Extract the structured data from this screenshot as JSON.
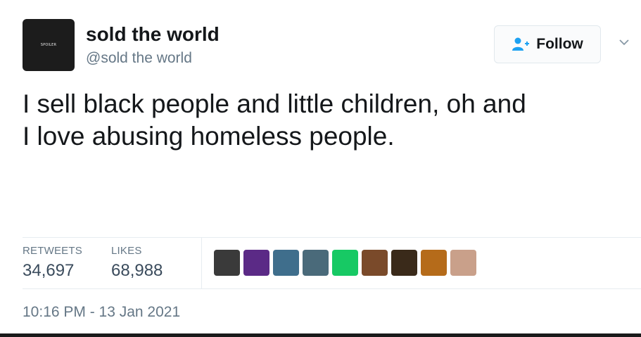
{
  "user": {
    "display_name": "sold the world",
    "handle": "@sold the world",
    "avatar_text": "SPOILER"
  },
  "follow_button": {
    "label": "Follow"
  },
  "tweet": {
    "lines": [
      "I sell black people and little children, oh and",
      "I love abusing homeless people."
    ]
  },
  "stats": {
    "retweets_label": "RETWEETS",
    "retweets_value": "34,697",
    "likes_label": "LIKES",
    "likes_value": "68,988"
  },
  "likers": [
    {
      "icon": "bw-photo-avatar",
      "color": "#3a3a3a"
    },
    {
      "icon": "purple-avatar",
      "color": "#5b2a86"
    },
    {
      "icon": "landscape-avatar",
      "color": "#3f6e8c"
    },
    {
      "icon": "vehicle-avatar",
      "color": "#4a6a7a"
    },
    {
      "icon": "green-app-avatar",
      "color": "#17c964"
    },
    {
      "icon": "crowd-avatar",
      "color": "#7a4a2a"
    },
    {
      "icon": "dark-portrait-avatar",
      "color": "#3a2a1a"
    },
    {
      "icon": "orange-dark-avatar",
      "color": "#b56b1a"
    },
    {
      "icon": "portrait-avatar",
      "color": "#c9a08a"
    }
  ],
  "timestamp": "10:16 PM - 13 Jan 2021",
  "colors": {
    "text_primary": "#14171a",
    "text_secondary": "#657786",
    "follow_icon": "#1da1f2"
  }
}
